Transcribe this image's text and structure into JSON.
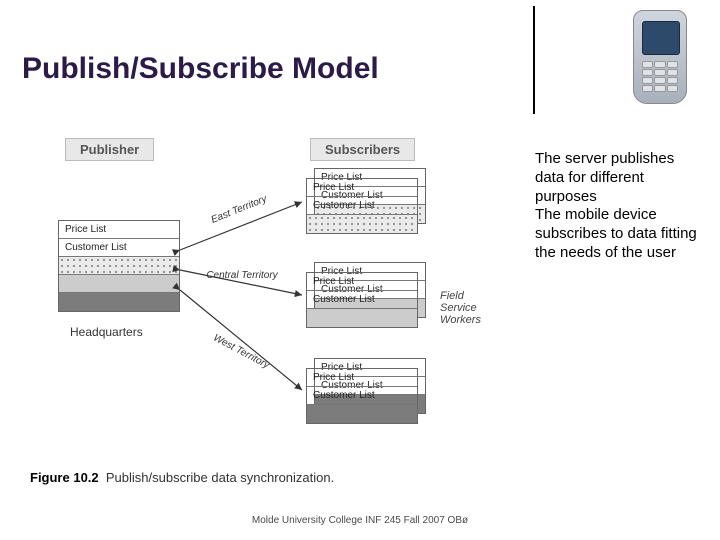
{
  "title": "Publish/Subscribe Model",
  "side_text": {
    "line1": "The server publishes data for different purposes",
    "line2": "The mobile device subscribes to data fitting the needs of the user"
  },
  "diagram": {
    "publisher_label": "Publisher",
    "subscribers_label": "Subscribers",
    "headquarters": "Headquarters",
    "field_service": "Field\nService\nWorkers",
    "publisher_rows": [
      "Price List",
      "Customer List",
      "",
      ""
    ],
    "territories": [
      "East Territory",
      "Central Territory",
      "West Territory"
    ],
    "subscriber_rows": [
      "Price List",
      "Customer List"
    ],
    "caption_label": "Figure 10.2",
    "caption_text": "Publish/subscribe data synchronization."
  },
  "footer": "Molde University College INF 245 Fall 2007 OBø"
}
